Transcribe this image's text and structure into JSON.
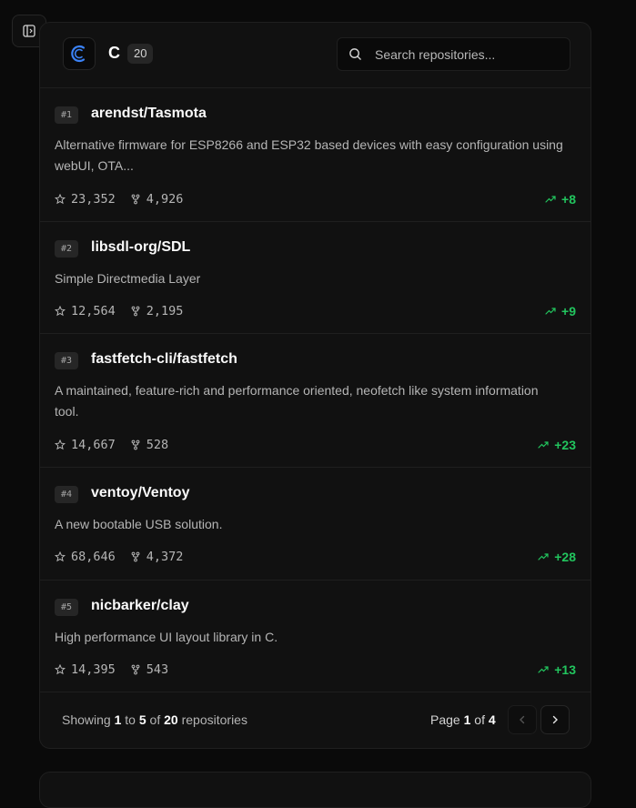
{
  "header": {
    "language": "C",
    "count": "20",
    "search_placeholder": "Search repositories..."
  },
  "repos": [
    {
      "rank": "#1",
      "name": "arendst/Tasmota",
      "description": "Alternative firmware for ESP8266 and ESP32 based devices with easy configuration using webUI, OTA...",
      "stars": "23,352",
      "forks": "4,926",
      "trend": "+8"
    },
    {
      "rank": "#2",
      "name": "libsdl-org/SDL",
      "description": "Simple Directmedia Layer",
      "stars": "12,564",
      "forks": "2,195",
      "trend": "+9"
    },
    {
      "rank": "#3",
      "name": "fastfetch-cli/fastfetch",
      "description": "A maintained, feature-rich and performance oriented, neofetch like system information tool.",
      "stars": "14,667",
      "forks": "528",
      "trend": "+23"
    },
    {
      "rank": "#4",
      "name": "ventoy/Ventoy",
      "description": "A new bootable USB solution.",
      "stars": "68,646",
      "forks": "4,372",
      "trend": "+28"
    },
    {
      "rank": "#5",
      "name": "nicbarker/clay",
      "description": "High performance UI layout library in C.",
      "stars": "14,395",
      "forks": "543",
      "trend": "+13"
    }
  ],
  "footer": {
    "showing_prefix": "Showing",
    "from": "1",
    "to_word": "to",
    "to": "5",
    "of_word": "of",
    "total": "20",
    "suffix": "repositories",
    "page_word": "Page",
    "page": "1",
    "page_of": "of",
    "pages": "4"
  },
  "colors": {
    "accent_trend": "#22c55e",
    "logo_blue": "#3b82f6"
  },
  "icons": {
    "sidebar_toggle": "sidebar-toggle-icon",
    "search": "search-icon",
    "star": "star-icon",
    "fork": "fork-icon",
    "trend": "trending-up-icon",
    "prev": "chevron-left-icon",
    "next": "chevron-right-icon"
  }
}
